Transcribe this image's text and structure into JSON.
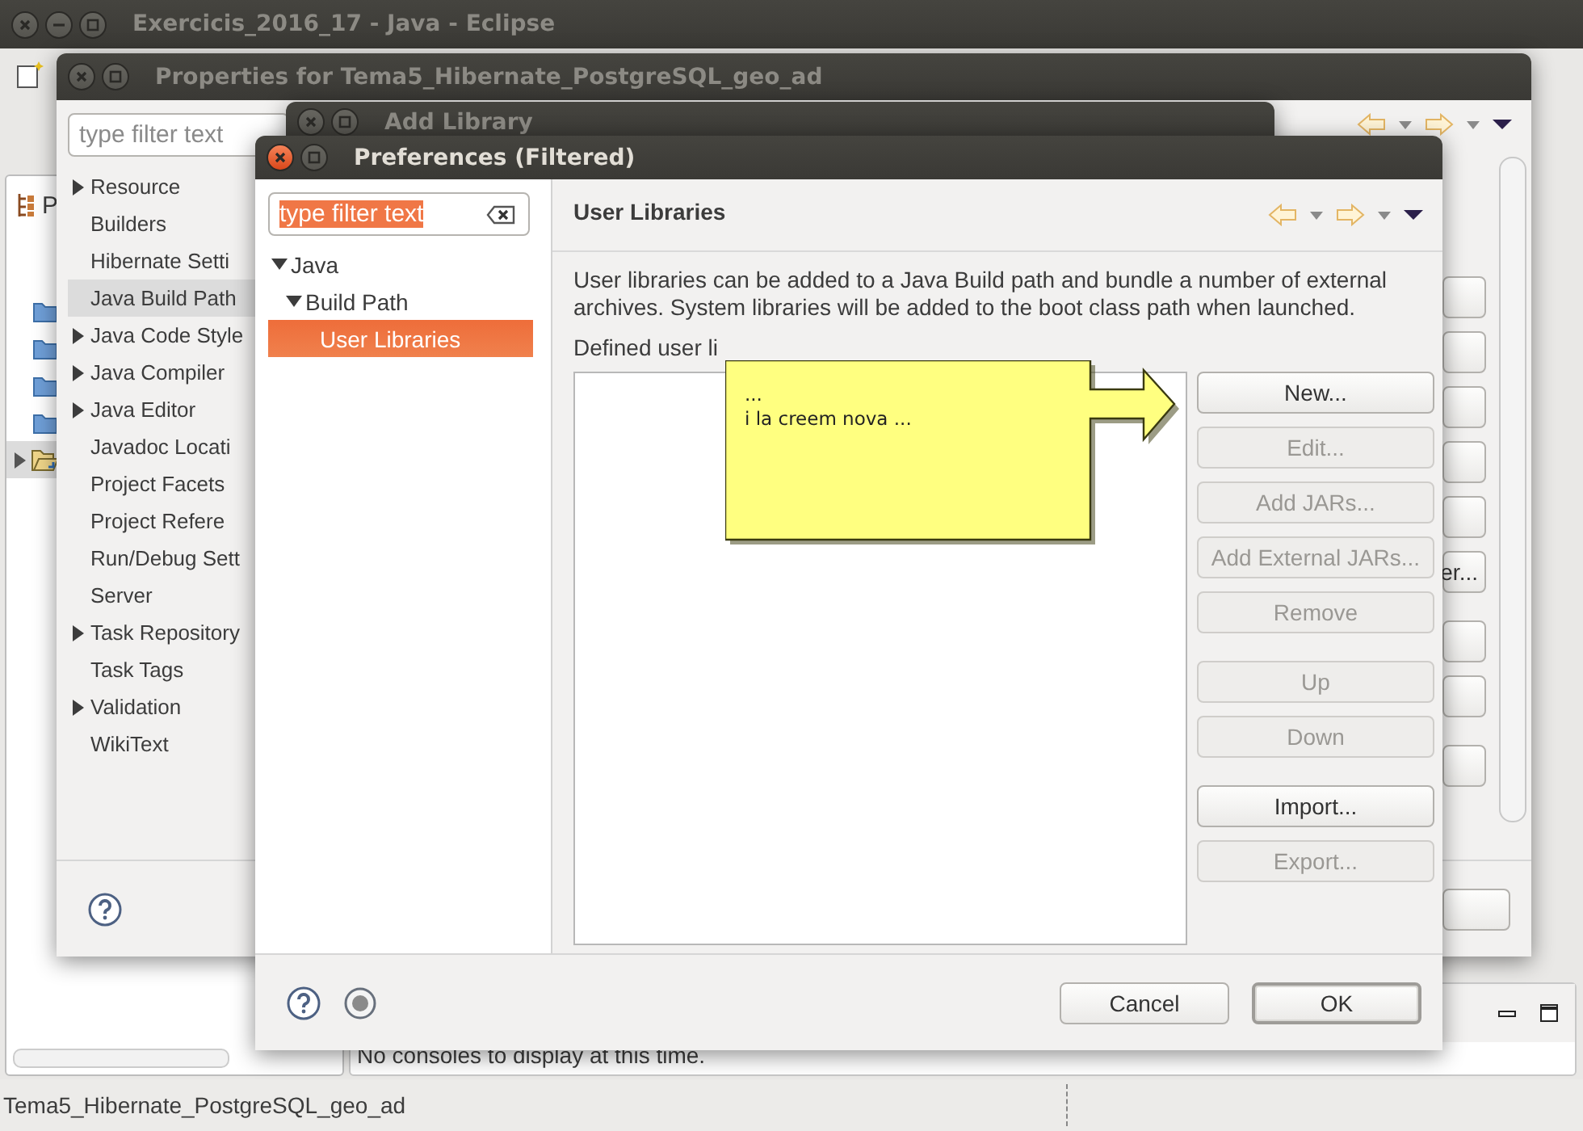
{
  "window": {
    "title": "Exercicis_2016_17 - Java - Eclipse"
  },
  "workbench": {
    "view_tab": "P",
    "console_message": "No consoles to display at this time.",
    "status_bar": "Tema5_Hibernate_PostgreSQL_geo_ad"
  },
  "properties_dialog": {
    "title": "Properties for Tema5_Hibernate_PostgreSQL_geo_ad",
    "filter": {
      "placeholder": "type filter text"
    },
    "items": [
      {
        "label": "Resource",
        "has_children": true,
        "selected": false
      },
      {
        "label": "Builders",
        "has_children": false,
        "selected": false
      },
      {
        "label": "Hibernate Setti",
        "has_children": false,
        "selected": false
      },
      {
        "label": "Java Build Path",
        "has_children": false,
        "selected": true
      },
      {
        "label": "Java Code Style",
        "has_children": true,
        "selected": false
      },
      {
        "label": "Java Compiler",
        "has_children": true,
        "selected": false
      },
      {
        "label": "Java Editor",
        "has_children": true,
        "selected": false
      },
      {
        "label": "Javadoc Locati",
        "has_children": false,
        "selected": false
      },
      {
        "label": "Project Facets",
        "has_children": false,
        "selected": false
      },
      {
        "label": "Project Refere",
        "has_children": false,
        "selected": false
      },
      {
        "label": "Run/Debug Sett",
        "has_children": false,
        "selected": false
      },
      {
        "label": "Server",
        "has_children": false,
        "selected": false
      },
      {
        "label": "Task Repository",
        "has_children": true,
        "selected": false
      },
      {
        "label": "Task Tags",
        "has_children": false,
        "selected": false
      },
      {
        "label": "Validation",
        "has_children": true,
        "selected": false
      },
      {
        "label": "WikiText",
        "has_children": false,
        "selected": false
      }
    ],
    "side_button": "er..."
  },
  "add_library_dialog": {
    "title": "Add Library"
  },
  "preferences_dialog": {
    "title": "Preferences (Filtered)",
    "filter": {
      "value": "type filter text"
    },
    "tree": [
      {
        "label": "Java",
        "expanded": true,
        "selected": false,
        "children": [
          {
            "label": "Build Path",
            "expanded": true,
            "selected": false,
            "children": [
              {
                "label": "User Libraries",
                "selected": true
              }
            ]
          }
        ]
      }
    ],
    "page_title": "User Libraries",
    "description": "User libraries can be added to a Java Build path and bundle a number of external archives. System libraries will be added to the boot class path when launched.",
    "list_label": "Defined user li",
    "button_groups": [
      [
        {
          "label": "New...",
          "disabled": false
        },
        {
          "label": "Edit...",
          "disabled": true
        },
        {
          "label": "Add JARs...",
          "disabled": true
        },
        {
          "label": "Add External JARs...",
          "disabled": true
        },
        {
          "label": "Remove",
          "disabled": true
        }
      ],
      [
        {
          "label": "Up",
          "disabled": true
        },
        {
          "label": "Down",
          "disabled": true
        }
      ],
      [
        {
          "label": "Import...",
          "disabled": false
        },
        {
          "label": "Export...",
          "disabled": true
        }
      ]
    ],
    "footer_buttons": [
      {
        "label": "Cancel",
        "default": false
      },
      {
        "label": "OK",
        "default": true
      }
    ]
  },
  "callout": {
    "text": "...\ni la creem nova ..."
  }
}
